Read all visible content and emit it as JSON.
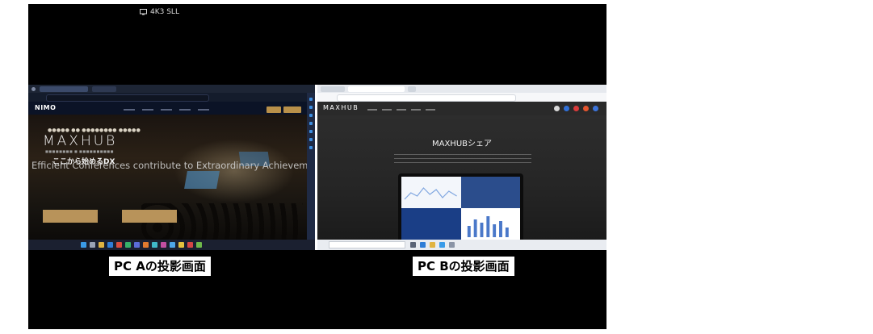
{
  "top_indicator": {
    "text": "4K3 SLL"
  },
  "pc_a": {
    "site_logo": "NIMO",
    "hero_brand": "MAXHUB",
    "hero_headline": "ここから始めるDX",
    "hero_tagline": "Efficient Conferences contribute to Extraordinary Achievements."
  },
  "pc_b": {
    "site_logo": "MAXHUB",
    "page_title": "MAXHUBシェア"
  },
  "captions": {
    "pc_a": "PC Aの投影画面",
    "pc_b": "PC Bの投影画面"
  },
  "colors": {
    "frame_background": "#000000",
    "accent_gold": "#b8935a",
    "caption_background": "#ffffff"
  }
}
